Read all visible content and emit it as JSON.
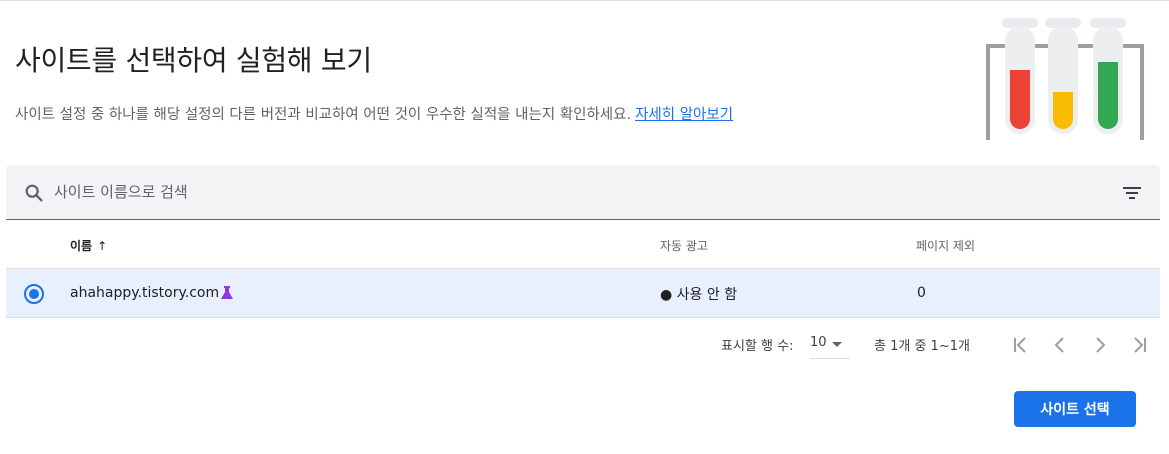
{
  "header": {
    "title": "사이트를 선택하여 실험해 보기",
    "description": "사이트 설정 중 하나를 해당 설정의 다른 버전과 비교하여 어떤 것이 우수한 실적을 내는지 확인하세요.",
    "learn_more": "자세히 알아보기"
  },
  "search": {
    "placeholder": "사이트 이름으로 검색",
    "value": ""
  },
  "table": {
    "columns": {
      "name": "이름",
      "sort_arrow": "↑",
      "auto_ads": "자동 광고",
      "excluded_pages": "페이지 제외"
    },
    "rows": [
      {
        "selected": true,
        "site": "ahahappy.tistory.com",
        "auto_ads": "● 사용 안 함",
        "excluded_pages": "0"
      }
    ]
  },
  "pagination": {
    "rows_label": "표시할 행 수:",
    "rows_value": "10",
    "range": "총 1개 중 1~1개"
  },
  "footer": {
    "select_button": "사이트 선택"
  },
  "icons": {
    "search": "search-icon",
    "filter": "filter-icon",
    "flask": "flask-icon",
    "first_page": "first-page-icon",
    "prev_page": "chevron-left-icon",
    "next_page": "chevron-right-icon",
    "last_page": "last-page-icon"
  },
  "colors": {
    "accent": "#1a73e8",
    "selected_row": "#e8f0fe",
    "search_bg": "#f1f3f4",
    "flask": "#9334e6",
    "tube_red": "#ea4335",
    "tube_yellow": "#fbbc04",
    "tube_green": "#34a853"
  }
}
